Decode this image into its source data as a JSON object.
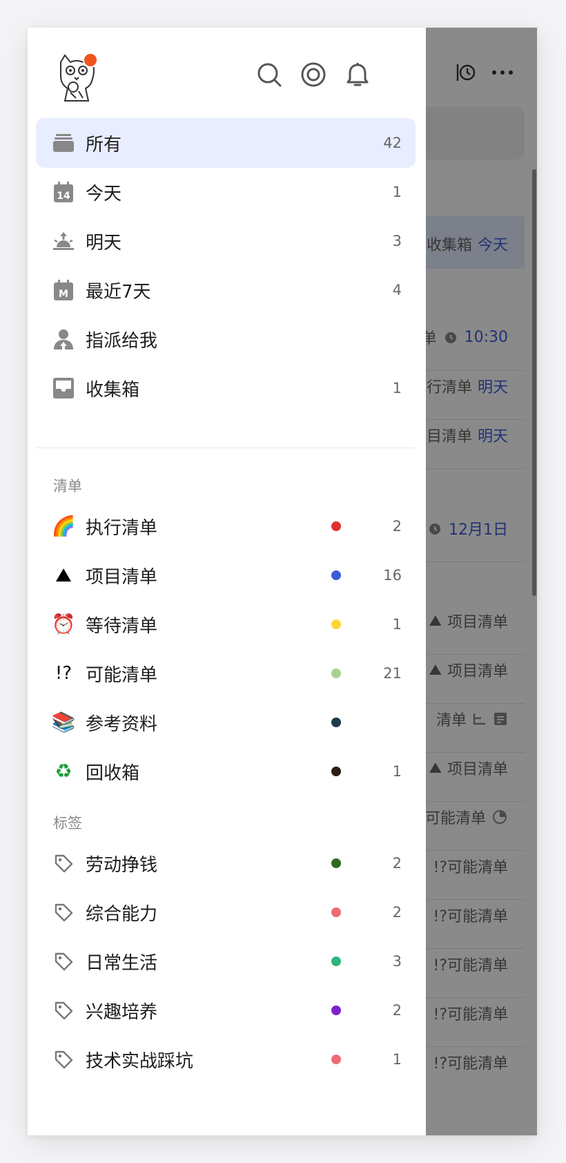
{
  "background_view": {
    "rows": [
      {
        "text": "收集箱",
        "date": "今天"
      },
      {
        "text": "单",
        "date": "10:30"
      },
      {
        "text": "行清单",
        "date": "明天"
      },
      {
        "text": "目清单",
        "date": "明天"
      },
      {
        "text": "",
        "date": "12月1日"
      },
      {
        "text": "项目清单",
        "date": ""
      },
      {
        "text": "项目清单",
        "date": ""
      },
      {
        "text": "清单",
        "date": ""
      },
      {
        "text": "项目清单",
        "date": ""
      },
      {
        "text": "可能清单",
        "date": ""
      },
      {
        "text": "!?可能清单",
        "date": ""
      },
      {
        "text": "!?可能清单",
        "date": ""
      },
      {
        "text": "!?可能清单",
        "date": ""
      },
      {
        "text": "!?可能清单",
        "date": ""
      },
      {
        "text": "!?可能清单",
        "date": ""
      }
    ]
  },
  "drawer": {
    "smart_lists": [
      {
        "icon": "inbox-stack-icon",
        "label": "所有",
        "count": "42",
        "active": true
      },
      {
        "icon": "calendar-today-icon",
        "label": "今天",
        "count": "1",
        "glyph": "14"
      },
      {
        "icon": "sunrise-icon",
        "label": "明天",
        "count": "3"
      },
      {
        "icon": "calendar-week-icon",
        "label": "最近7天",
        "count": "4",
        "glyph": "M"
      },
      {
        "icon": "assigned-user-icon",
        "label": "指派给我",
        "count": ""
      },
      {
        "icon": "inbox-tray-icon",
        "label": "收集箱",
        "count": "1"
      }
    ],
    "lists_title": "清单",
    "lists": [
      {
        "emoji": "🌈",
        "label": "执行清单",
        "color": "#e03131",
        "count": "2"
      },
      {
        "emoji": "⛰",
        "label": "项目清单",
        "color": "#3b5bdb",
        "count": "16"
      },
      {
        "emoji": "⏰",
        "label": "等待清单",
        "color": "#ffd43b",
        "count": "1"
      },
      {
        "emoji": "!?",
        "label": "可能清单",
        "color": "#a9d18e",
        "count": "21"
      },
      {
        "emoji": "📚",
        "label": "参考资料",
        "color": "#1c3a4a",
        "count": ""
      },
      {
        "emoji": "♻",
        "label": "回收箱",
        "color": "#2b1d14",
        "count": "1"
      }
    ],
    "tags_title": "标签",
    "tags": [
      {
        "label": "劳动挣钱",
        "color": "#2f6b1f",
        "count": "2"
      },
      {
        "label": "综合能力",
        "color": "#ef6b73",
        "count": "2"
      },
      {
        "label": "日常生活",
        "color": "#2fb67b",
        "count": "3"
      },
      {
        "label": "兴趣培养",
        "color": "#7e22ce",
        "count": "2"
      },
      {
        "label": "技术实战踩坑",
        "color": "#ef6b73",
        "count": "1"
      }
    ]
  }
}
